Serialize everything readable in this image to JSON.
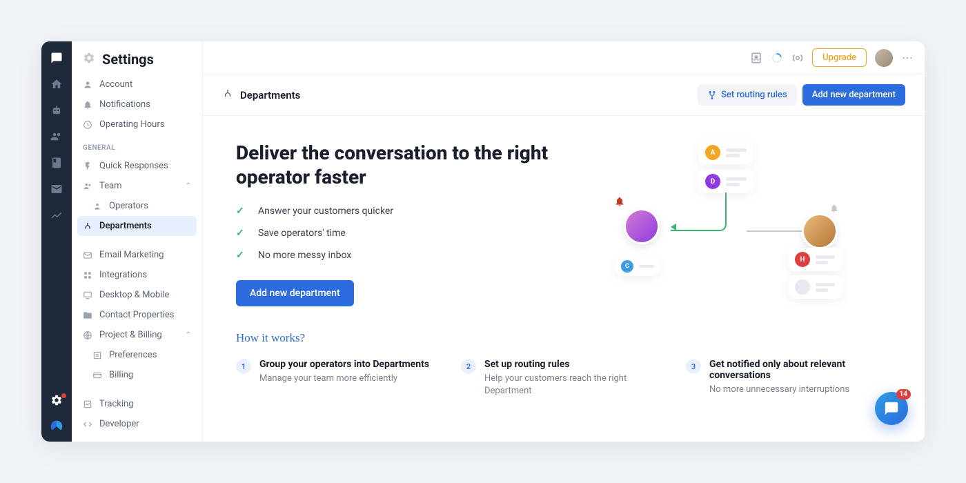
{
  "colors": {
    "primary": "#2d6cdf",
    "accent": "#f5a623",
    "danger": "#e03e3e",
    "success": "#3cb371"
  },
  "navbar": {
    "icons": [
      "chat",
      "home",
      "bot",
      "users",
      "book",
      "mail",
      "analytics"
    ],
    "bottom_icons": [
      "settings",
      "logo"
    ]
  },
  "sidebar": {
    "title": "Settings",
    "top_items": [
      {
        "icon": "person",
        "label": "Account"
      },
      {
        "icon": "bell",
        "label": "Notifications"
      },
      {
        "icon": "clock",
        "label": "Operating Hours"
      }
    ],
    "general_label": "GENERAL",
    "general_items": [
      {
        "icon": "bolt",
        "label": "Quick Responses",
        "chev": false
      },
      {
        "icon": "team",
        "label": "Team",
        "chev": true,
        "expanded": true
      },
      {
        "icon": "operator",
        "label": "Operators",
        "sub": true
      },
      {
        "icon": "department",
        "label": "Departments",
        "sub": true,
        "active": true
      },
      {
        "icon": "mail",
        "label": "Email Marketing"
      },
      {
        "icon": "grid",
        "label": "Integrations"
      },
      {
        "icon": "device",
        "label": "Desktop & Mobile"
      },
      {
        "icon": "folder",
        "label": "Contact Properties"
      },
      {
        "icon": "globe",
        "label": "Project & Billing",
        "chev": true,
        "expanded": true
      },
      {
        "icon": "pref",
        "label": "Preferences",
        "sub": true
      },
      {
        "icon": "card",
        "label": "Billing",
        "sub": true
      },
      {
        "icon": "track",
        "label": "Tracking"
      },
      {
        "icon": "code",
        "label": "Developer"
      }
    ]
  },
  "topbar": {
    "upgrade_label": "Upgrade"
  },
  "page": {
    "title": "Departments",
    "routing_btn": "Set routing rules",
    "add_btn": "Add new department"
  },
  "hero": {
    "headline": "Deliver the conversation to the right operator faster",
    "features": [
      "Answer your customers quicker",
      "Save operators' time",
      "No more messy inbox"
    ],
    "cta": "Add new department"
  },
  "illustration": {
    "badges": [
      {
        "letter": "A",
        "color": "#f5a623"
      },
      {
        "letter": "D",
        "color": "#8e3cdf"
      },
      {
        "letter": "C",
        "color": "#3c9cdf"
      },
      {
        "letter": "H",
        "color": "#e03e3e"
      }
    ]
  },
  "how_it_works": {
    "title": "How it works?",
    "steps": [
      {
        "num": "1",
        "title": "Group your operators into Departments",
        "desc": "Manage your team more efficiently"
      },
      {
        "num": "2",
        "title": "Set up routing rules",
        "desc": "Help your customers reach the right Department"
      },
      {
        "num": "3",
        "title": "Get notified only about relevant conversations",
        "desc": "No more unnecessary interruptions"
      }
    ]
  },
  "fab": {
    "badge": "14"
  }
}
